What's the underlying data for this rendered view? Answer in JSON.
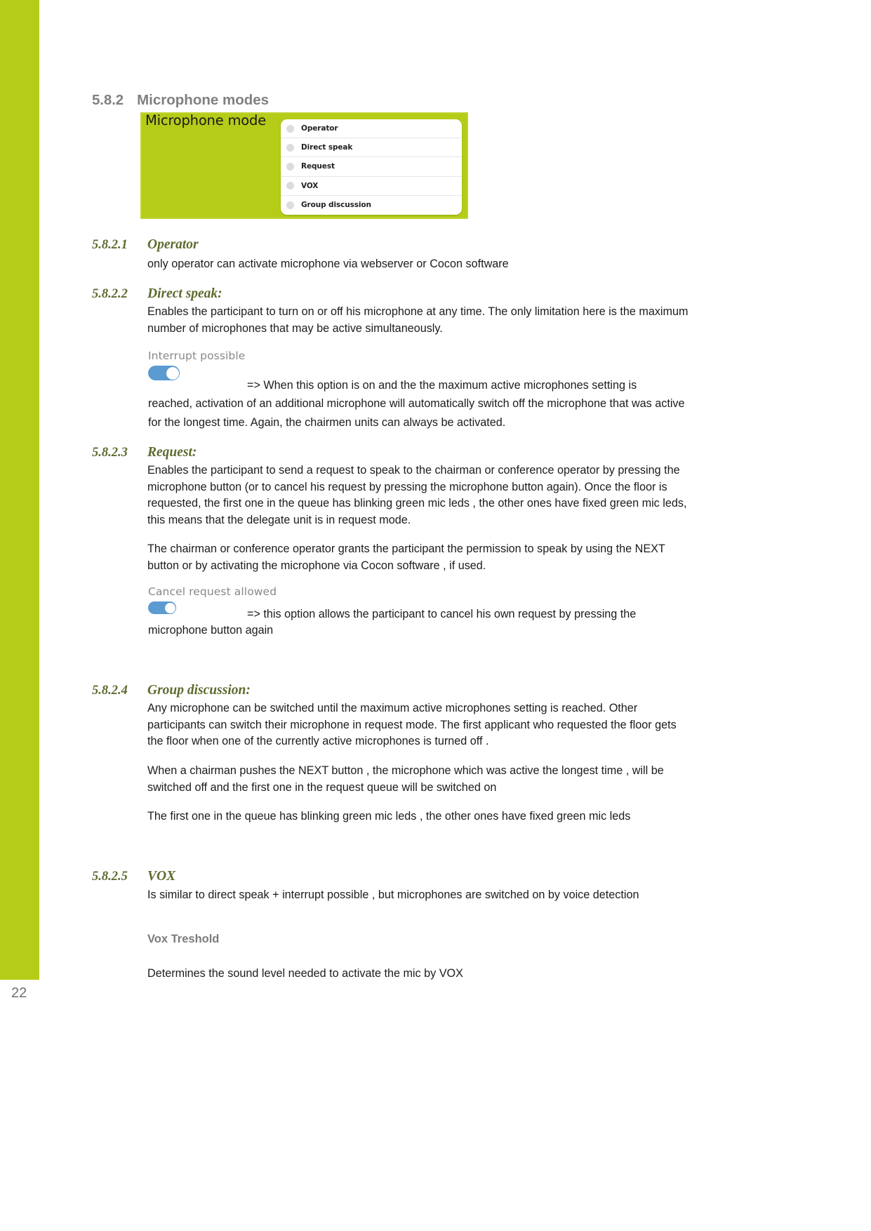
{
  "page": {
    "number": "22",
    "accent_green": "#b5cc18",
    "heading_gray": "#808080",
    "subheading_olive": "#5d6b2f",
    "toggle_blue": "#5b9bd1"
  },
  "heading": {
    "number": "5.8.2",
    "title": "Microphone modes"
  },
  "screenshot_widget": {
    "panel_label": "Microphone mode",
    "options": [
      {
        "label": "Operator",
        "selected": false
      },
      {
        "label": "Direct speak",
        "selected": false
      },
      {
        "label": "Request",
        "selected": false
      },
      {
        "label": "VOX",
        "selected": false
      },
      {
        "label": "Group discussion",
        "selected": false
      }
    ]
  },
  "sections": [
    {
      "number": "5.8.2.1",
      "title": "Operator",
      "paragraphs": [
        "only operator can activate microphone via webserver or Cocon software"
      ]
    },
    {
      "number": "5.8.2.2",
      "title": "Direct speak:",
      "paragraphs": [
        "Enables the participant to turn on or off his microphone at any time. The only limitation here is the maximum number of microphones that may be active simultaneously."
      ]
    },
    {
      "number": "5.8.2.3",
      "title": "Request:",
      "paragraphs": [
        "Enables the participant to send a request to speak to the chairman or conference operator by pressing the microphone button (or to cancel his request by pressing the microphone button again). Once the floor is requested, the first one in the queue has blinking green mic leds , the other ones have fixed green mic leds, this means that the delegate unit is in request mode.",
        "The chairman or conference operator grants the participant the permission to speak by using the NEXT button or by activating the microphone via Cocon software , if used."
      ]
    },
    {
      "number": "5.8.2.4",
      "title": "Group discussion:",
      "paragraphs": [
        "Any microphone can be switched until the maximum active microphones setting is reached. Other participants can switch their microphone in request mode. The first applicant who requested the floor gets the floor when one of the currently active microphones is turned off .",
        "When a chairman pushes the NEXT button , the microphone which was active the longest time , will be switched off and the first one in the request queue will be switched on",
        "The first one in the queue has blinking green mic leds , the other ones have fixed green mic leds"
      ]
    },
    {
      "number": "5.8.2.5",
      "title": "VOX",
      "paragraphs": [
        "Is similar to direct speak + interrupt possible , but microphones are switched on by voice detection"
      ]
    }
  ],
  "toggles": {
    "interrupt": {
      "label": "Interrupt possible",
      "state": "on",
      "description": "=> When this option is on and the the maximum active microphones setting is reached, activation of an additional microphone will automatically switch off the microphone that was active for the longest time.  Again, the chairmen units can always be activated.",
      "description_first_line": "=> When this option is on and the the maximum active microphones setting is",
      "description_rest": "reached, activation of an additional microphone will automatically switch off the microphone that was active for the longest time.  Again, the chairmen units can always be activated."
    },
    "cancel_request": {
      "label": "Cancel request allowed",
      "state": "on",
      "description_first_line": "=> this option allows the participant to cancel his own request by pressing the",
      "description_rest": "microphone button again"
    }
  },
  "vox_threshold": {
    "label": "Vox Treshold",
    "description": "Determines the sound level needed to activate the mic by VOX"
  }
}
